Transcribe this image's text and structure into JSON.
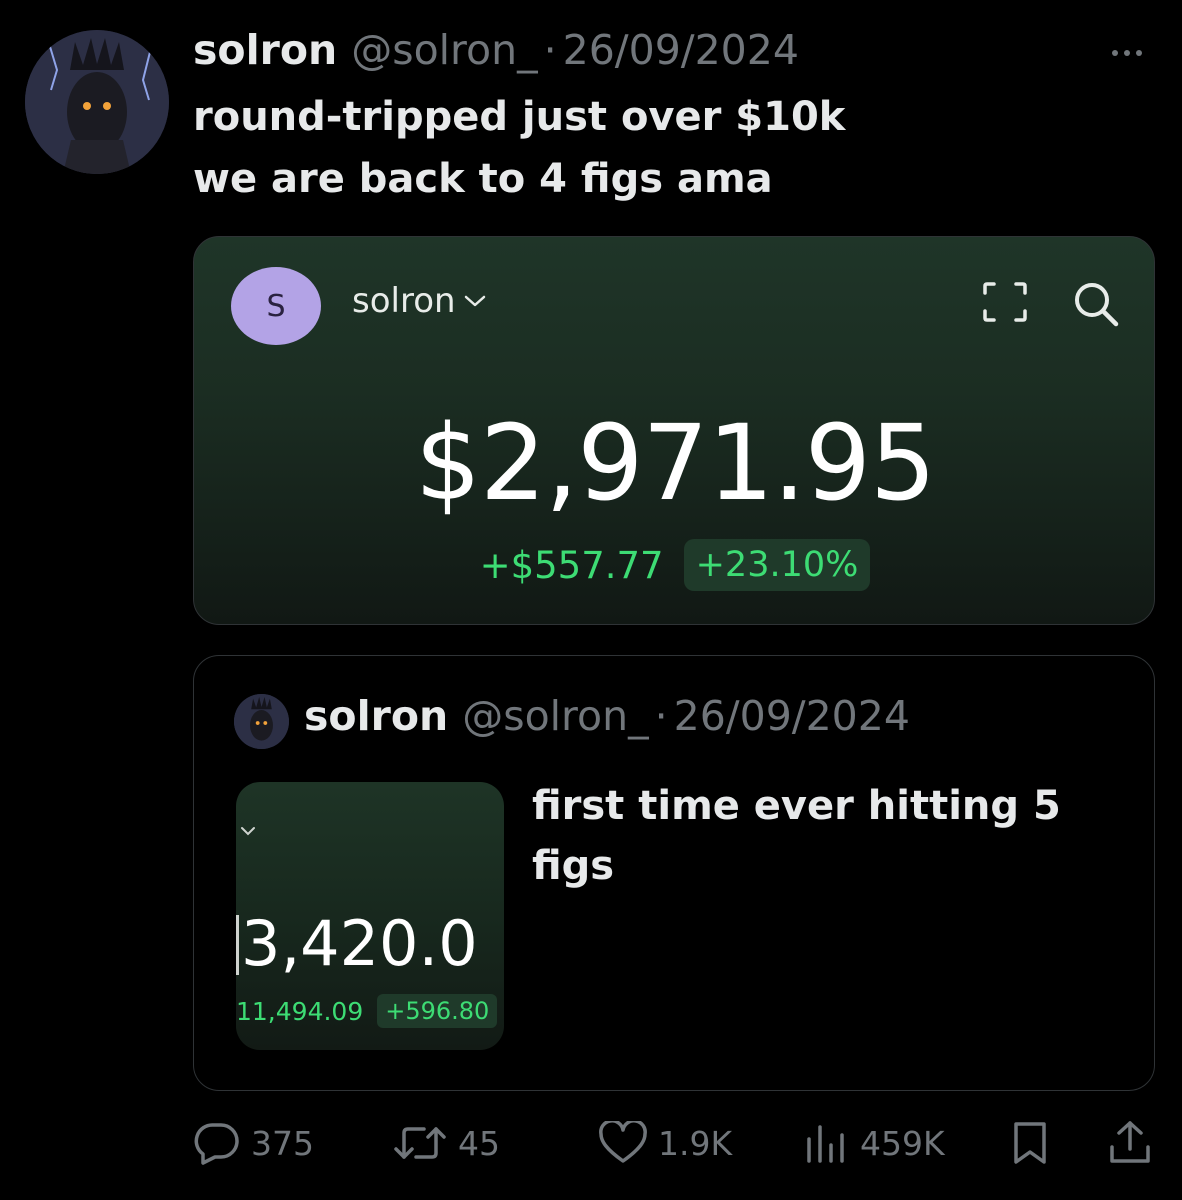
{
  "tweet": {
    "author_name": "solron",
    "handle": "@solron_",
    "separator": "·",
    "date": "26/09/2024",
    "text_line1": "round-tripped just over $10k",
    "text_line2": "we are back to 4 figs ama"
  },
  "card": {
    "avatar_letter": "S",
    "account_name": "solron",
    "balance": "$2,971.95",
    "change_amount": "+$557.77",
    "change_percent": "+23.10%"
  },
  "quote": {
    "author_name": "solron",
    "handle": "@solron_",
    "separator": "·",
    "date": "26/09/2024",
    "text": "first time ever hitting 5 figs",
    "thumb_balance": "3,420.0",
    "thumb_change_amount": "11,494.09",
    "thumb_change_percent": "+596.80"
  },
  "actions": {
    "replies": "375",
    "reposts": "45",
    "likes": "1.9K",
    "views": "459K"
  },
  "colors": {
    "background": "#000000",
    "muted": "#71767b",
    "gain_green": "#3ddc74",
    "card_green": "#1f3528"
  },
  "icons": [
    "more-icon",
    "chevron-down-icon",
    "scan-icon",
    "search-icon",
    "reply-icon",
    "repost-icon",
    "like-icon",
    "views-icon",
    "bookmark-icon",
    "share-icon"
  ]
}
